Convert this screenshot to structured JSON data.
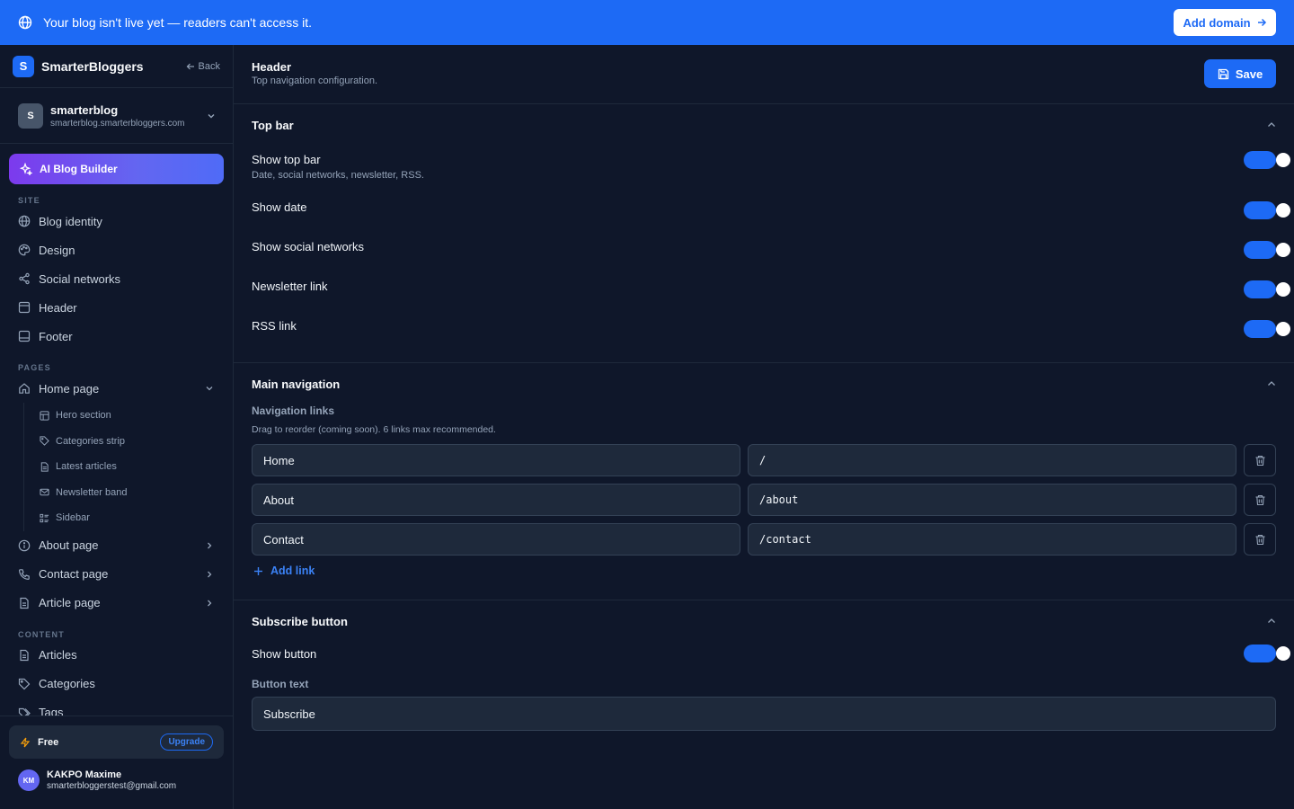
{
  "banner": {
    "message": "Your blog isn't live yet — readers can't access it.",
    "button": "Add domain",
    "color": "#1d6af5"
  },
  "sidebar": {
    "brand": {
      "logo_letter": "S",
      "name": "SmarterBloggers",
      "back": "Back"
    },
    "blog": {
      "avatar": "S",
      "name": "smarterblog",
      "url": "smarterblog.smarterbloggers.com"
    },
    "ai_button": "AI Blog Builder",
    "sections": {
      "site": {
        "label": "SITE",
        "items": [
          "Blog identity",
          "Design",
          "Social networks",
          "Header",
          "Footer"
        ]
      },
      "pages": {
        "label": "PAGES",
        "home": "Home page",
        "home_children": [
          "Hero section",
          "Categories strip",
          "Latest articles",
          "Newsletter band",
          "Sidebar"
        ],
        "items": [
          "About page",
          "Contact page",
          "Article page"
        ]
      },
      "content": {
        "label": "CONTENT",
        "items": [
          "Articles",
          "Categories",
          "Tags"
        ]
      }
    },
    "plan": {
      "name": "Free",
      "upgrade": "Upgrade"
    },
    "user": {
      "initials": "KM",
      "name": "KAKPO Maxime",
      "email": "smarterbloggerstest@gmail.com"
    }
  },
  "main": {
    "title": "Header",
    "subtitle": "Top navigation configuration.",
    "save": "Save",
    "top_bar": {
      "title": "Top bar",
      "toggles": [
        {
          "label": "Show top bar",
          "desc": "Date, social networks, newsletter, RSS.",
          "on": true
        },
        {
          "label": "Show date",
          "on": true
        },
        {
          "label": "Show social networks",
          "on": true
        },
        {
          "label": "Newsletter link",
          "on": true
        },
        {
          "label": "RSS link",
          "on": true
        }
      ]
    },
    "main_nav": {
      "title": "Main navigation",
      "label": "Navigation links",
      "hint": "Drag to reorder (coming soon). 6 links max recommended.",
      "links": [
        {
          "label": "Home",
          "url": "/"
        },
        {
          "label": "About",
          "url": "/about"
        },
        {
          "label": "Contact",
          "url": "/contact"
        }
      ],
      "add": "Add link"
    },
    "subscribe": {
      "title": "Subscribe button",
      "show_label": "Show button",
      "show_on": true,
      "text_label": "Button text",
      "text_value": "Subscribe"
    }
  }
}
